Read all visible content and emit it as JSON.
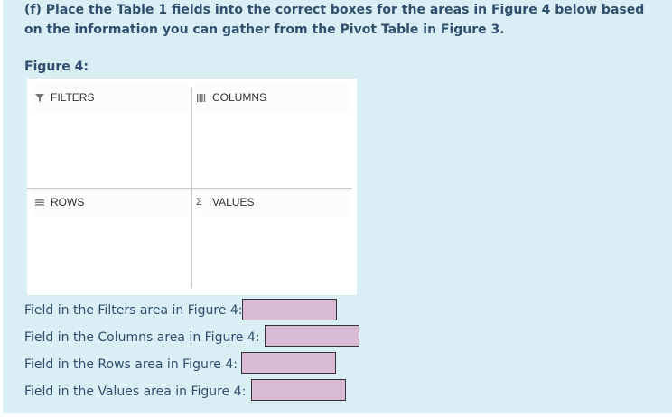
{
  "question": "(f) Place the Table 1 fields into the correct boxes for the areas in Figure 4 below based on the information you can gather from the Pivot Table in Figure 3.",
  "figure_label": "Figure 4:",
  "pivot": {
    "filters": {
      "label": "FILTERS",
      "icon": "funnel-icon"
    },
    "columns": {
      "label": "COLUMNS",
      "icon": "columns-icon"
    },
    "rows": {
      "label": "ROWS",
      "icon": "rows-icon"
    },
    "values": {
      "label": "VALUES",
      "icon": "sigma-icon",
      "glyph": "Σ"
    }
  },
  "answers": [
    {
      "label": "Field in the Filters area in Figure 4:",
      "value": ""
    },
    {
      "label": "Field in the Columns area in Figure 4:",
      "value": ""
    },
    {
      "label": "Field in the Rows area in Figure 4:",
      "value": ""
    },
    {
      "label": "Field in the Values area in Figure 4:",
      "value": ""
    }
  ],
  "colors": {
    "panel_bg": "#daeef6",
    "text": "#2e4f6e",
    "answer_fill": "#d9bbd6"
  }
}
